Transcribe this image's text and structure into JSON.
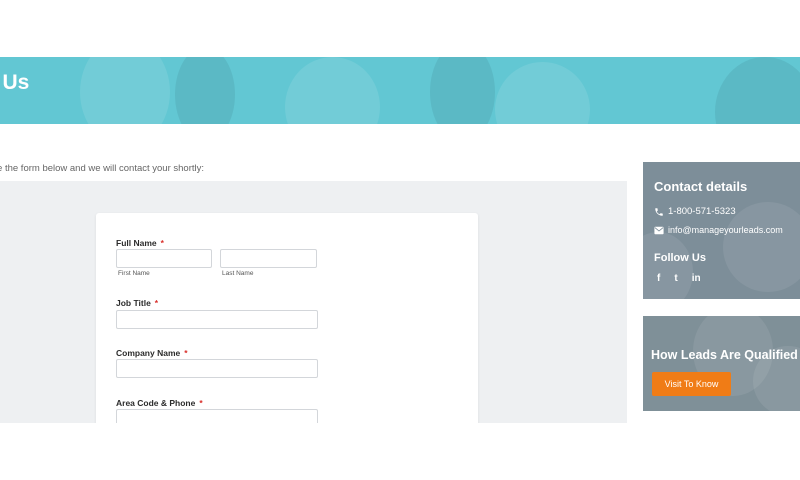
{
  "hero": {
    "title": "ct Us",
    "color": "#62c7d3"
  },
  "intro": {
    "text": "lete the form below and we will contact your shortly:"
  },
  "form": {
    "full_name": {
      "label": "Full Name",
      "required": "*",
      "first_sub_label": "First Name",
      "last_sub_label": "Last Name"
    },
    "job_title": {
      "label": "Job Title",
      "required": "*"
    },
    "company_name": {
      "label": "Company Name",
      "required": "*"
    },
    "phone": {
      "label": "Area Code & Phone",
      "required": "*"
    }
  },
  "sidebar": {
    "contact_card": {
      "title": "Contact details",
      "phone": "1-800-571-5323",
      "email": "info@manageyourleads.com",
      "follow_title": "Follow Us",
      "social_icons": [
        "facebook-icon",
        "twitter-icon",
        "linkedin-icon"
      ],
      "social_glyphs": {
        "facebook": "f",
        "twitter": "t",
        "linkedin": "in"
      }
    },
    "qualified_card": {
      "title": "How Leads Are Qualified",
      "button_label": "Visit To Know",
      "button_color": "#f07c16"
    }
  },
  "colors": {
    "required_marker": "#d9302b",
    "form_background": "#eef0f2",
    "sidebar_overlay": "#7d8e99"
  }
}
